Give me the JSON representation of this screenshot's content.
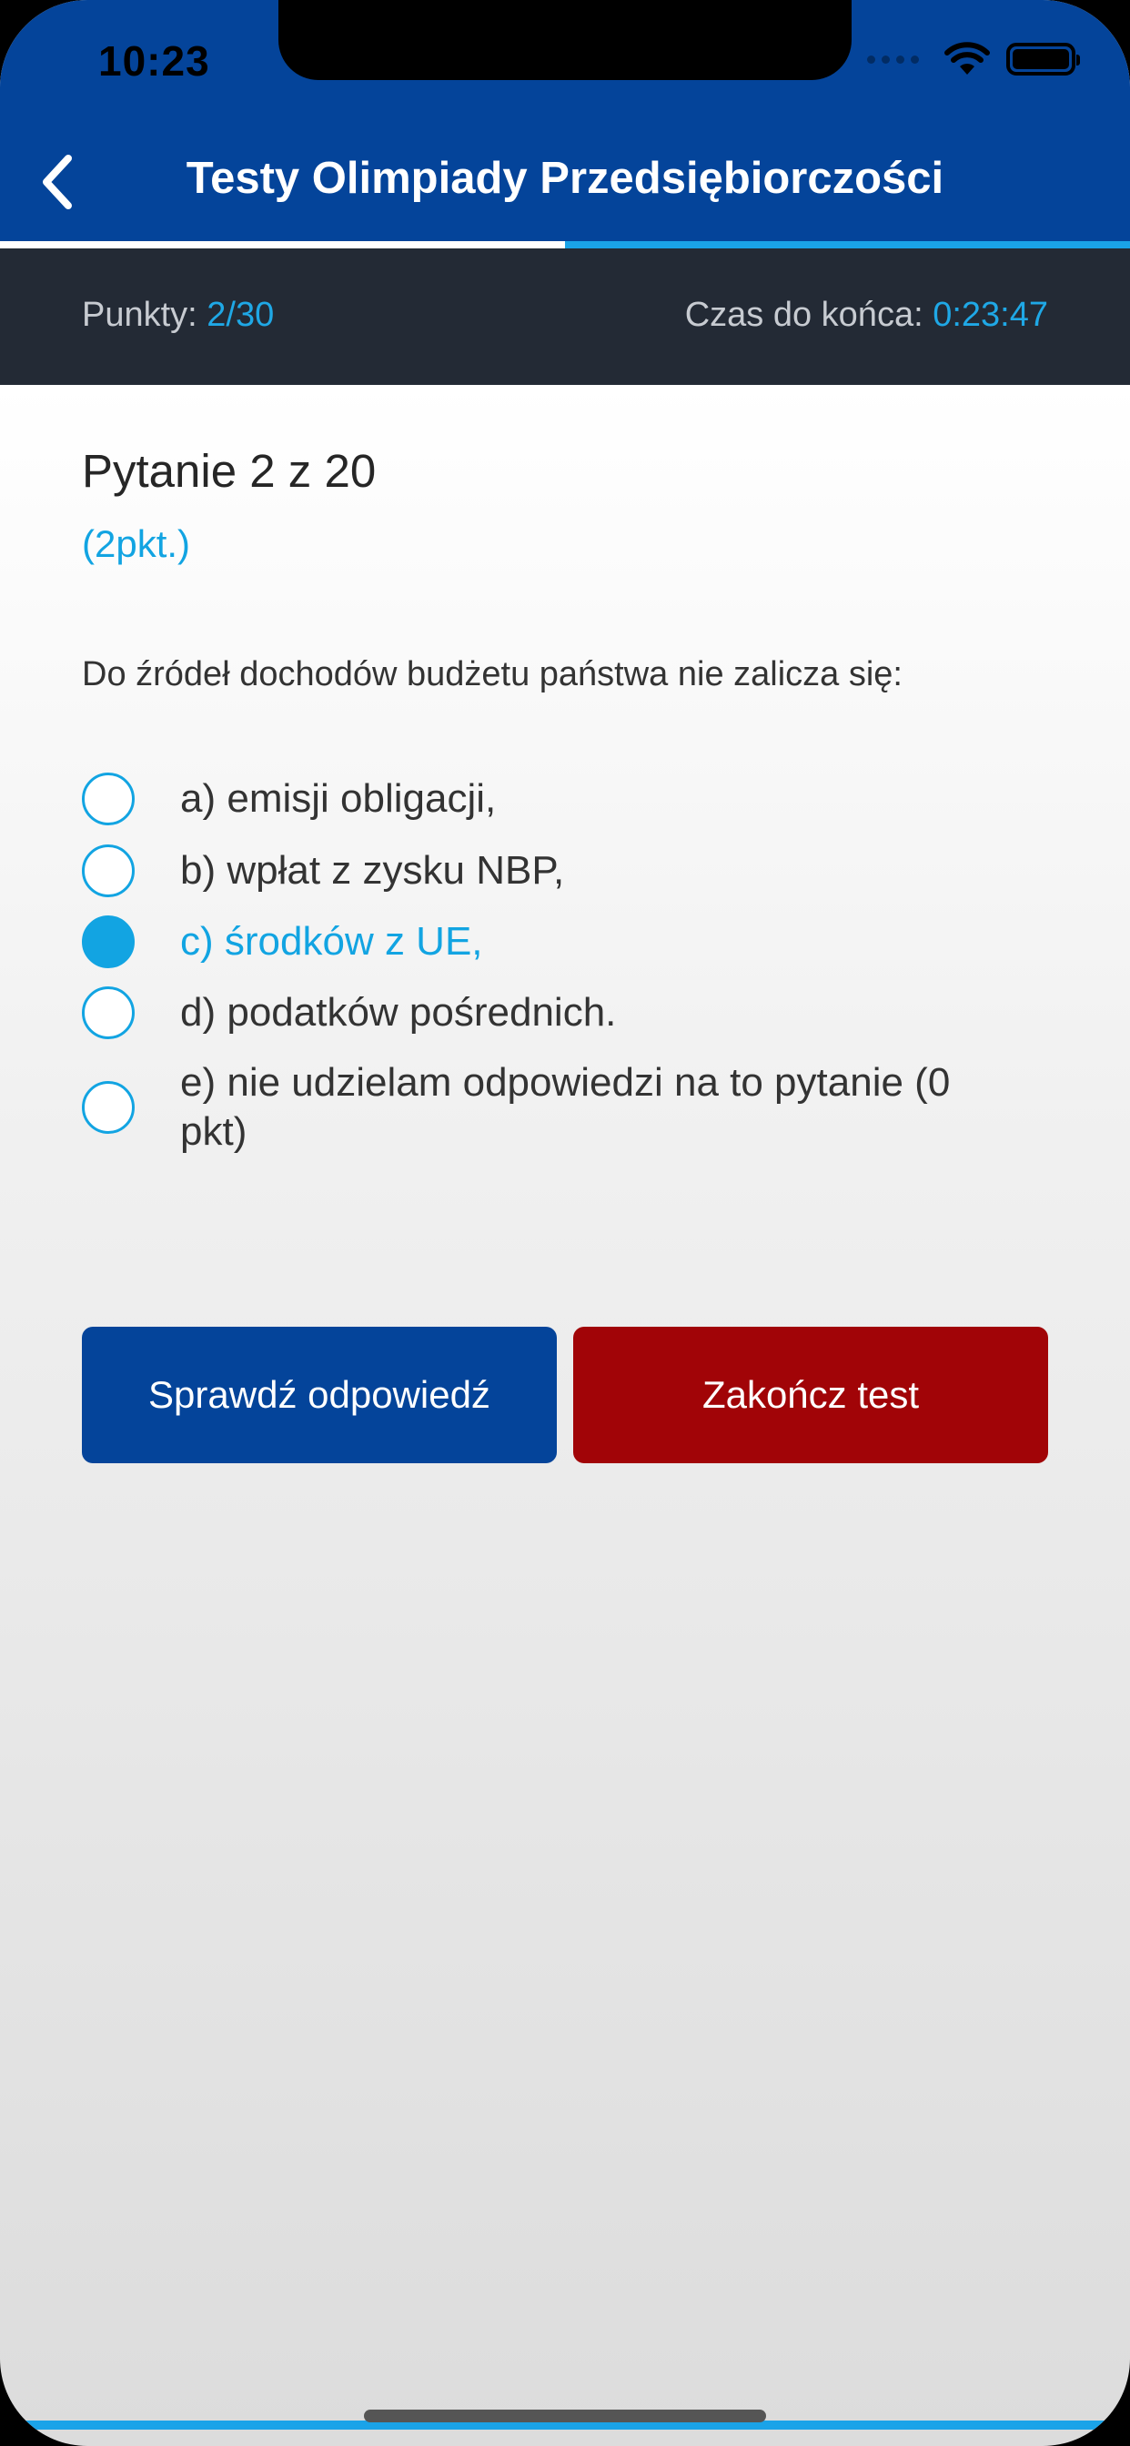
{
  "status_bar": {
    "time": "10:23"
  },
  "nav": {
    "title": "Testy Olimpiady Przedsiębiorczości",
    "back_icon": "chevron-left-icon"
  },
  "progress": {
    "fraction": 0.5
  },
  "stats": {
    "points_label": "Punkty: ",
    "points_value": "2/30",
    "time_label": "Czas do końca: ",
    "time_value": "0:23:47"
  },
  "question": {
    "number_text": "Pytanie 2 z 20",
    "points_text": "(2pkt.)",
    "text": "Do źródeł dochodów budżetu państwa nie zalicza się:"
  },
  "answers": [
    {
      "label": "a) emisji obligacji,",
      "selected": false
    },
    {
      "label": "b) wpłat z zysku NBP,",
      "selected": false
    },
    {
      "label": "c) środków z UE,",
      "selected": true
    },
    {
      "label": "d) podatków pośrednich.",
      "selected": false
    },
    {
      "label": "e) nie udzielam odpowiedzi na to pytanie (0 pkt)",
      "selected": false
    }
  ],
  "buttons": {
    "check_label": "Sprawdź odpowiedź",
    "finish_label": "Zakończ test"
  },
  "colors": {
    "header": "#04449a",
    "accent": "#12a4e2",
    "stats_bar": "#232a35",
    "finish": "#a10407"
  }
}
